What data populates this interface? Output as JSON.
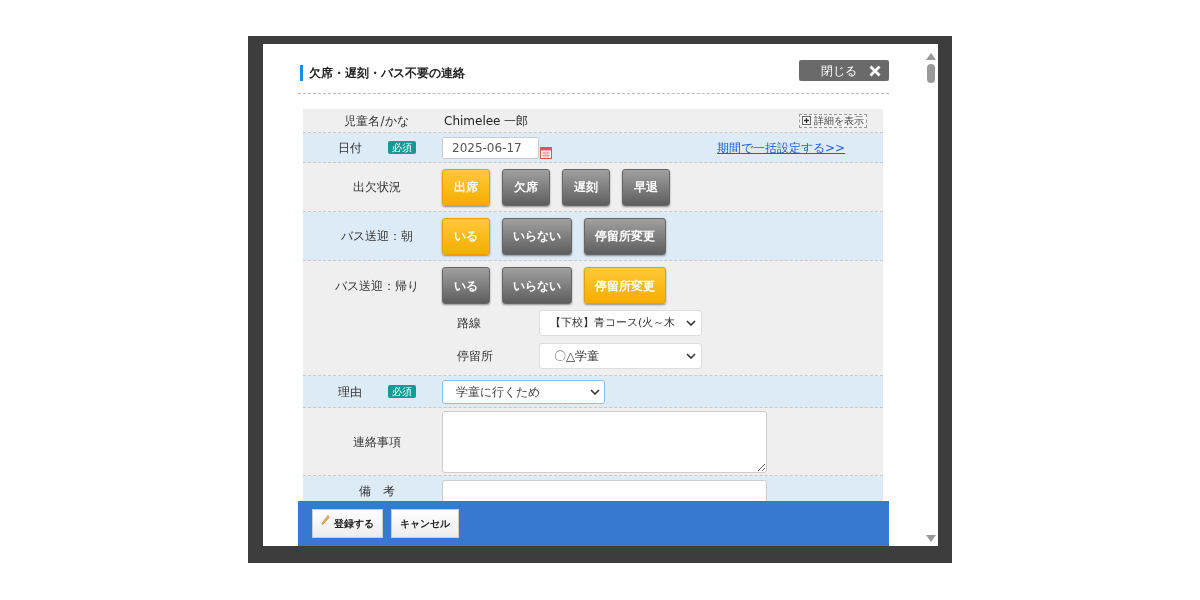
{
  "title": "欠席・遅刻・バス不要の連絡",
  "close_button": "閉じる",
  "child": {
    "label": "児童名/かな",
    "value": "Chimelee 一郎",
    "detail_button": "詳細を表示"
  },
  "date": {
    "label": "日付",
    "required": "必須",
    "value": "2025-06-17",
    "link": "期間で一括設定する>>"
  },
  "attendance": {
    "label": "出欠状況",
    "options": [
      {
        "label": "出席",
        "selected": true
      },
      {
        "label": "欠席",
        "selected": false
      },
      {
        "label": "遅刻",
        "selected": false
      },
      {
        "label": "早退",
        "selected": false
      }
    ]
  },
  "bus_morning": {
    "label": "バス送迎：朝",
    "options": [
      {
        "label": "いる",
        "selected": true
      },
      {
        "label": "いらない",
        "selected": false
      },
      {
        "label": "停留所変更",
        "selected": false
      }
    ]
  },
  "bus_return": {
    "label": "バス送迎：帰り",
    "options": [
      {
        "label": "いる",
        "selected": false
      },
      {
        "label": "いらない",
        "selected": false
      },
      {
        "label": "停留所変更",
        "selected": true
      }
    ],
    "route": {
      "label": "路線",
      "value": "【下校】青コース(火～木"
    },
    "stop": {
      "label": "停留所",
      "value": "〇△学童"
    }
  },
  "reason": {
    "label": "理由",
    "required": "必須",
    "value": "学童に行くため"
  },
  "contact": {
    "label": "連絡事項"
  },
  "remarks": {
    "label": "備　考"
  },
  "footer_buttons": [
    "登録する",
    "キャンセル"
  ]
}
